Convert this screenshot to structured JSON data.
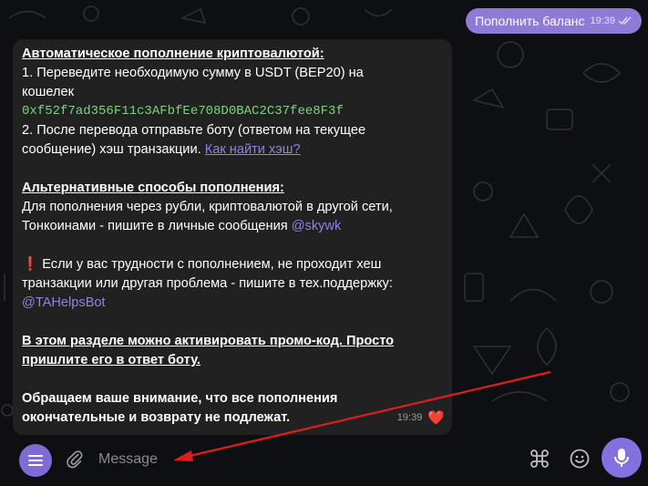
{
  "outgoing": {
    "text": "Пополнить баланс",
    "time": "19:39"
  },
  "incoming": {
    "heading1": "Автоматическое пополнение криптовалютой:",
    "step1a": "1. Переведите необходимую сумму в USDT (BEP20) на",
    "step1b": "кошелек",
    "wallet": "0xf52f7ad356F11c3AFbfEe708D0BAC2C37fee8F3f",
    "step2a": "2. После перевода отправьте боту (ответом на текущее",
    "step2b": "сообщение) хэш транзакции.",
    "hash_link": "Как найти хэш?",
    "heading2": "Альтернативные способы пополнения:",
    "alt1": "Для пополнения через рубли, криптовалютой в другой сети,",
    "alt2": "Тонкоинами - пишите в личные сообщения",
    "alt_user": "@skywk",
    "warn_icon": "❗",
    "warn1": "Если у вас трудности с пополнением, не проходит хеш",
    "warn2": "транзакции или другая проблема - пишите в тех.поддержку:",
    "support_user": "@TAHelpsBot",
    "promo1": "В этом разделе можно активировать промо-код. Просто",
    "promo2": "пришлите его в ответ боту.",
    "note1": "Обращаем ваше внимание, что все пополнения",
    "note2": "окончательные и возврату не подлежат.",
    "time": "19:39",
    "reaction": "❤️"
  },
  "composer": {
    "placeholder": "Message"
  },
  "colors": {
    "accent": "#8e7bd7",
    "link": "#8f84df",
    "wallet": "#7fd27f",
    "arrow": "#e01d1d"
  },
  "icons": [
    "menu-icon",
    "paperclip-icon",
    "command-icon",
    "emoji-icon",
    "microphone-icon",
    "double-check-icon"
  ]
}
